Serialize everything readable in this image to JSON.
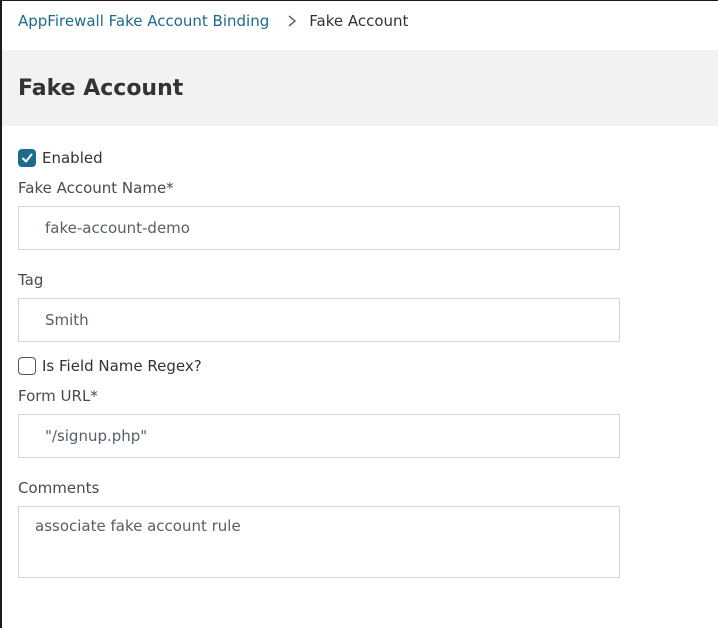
{
  "breadcrumb": {
    "parent": "AppFirewall Fake Account Binding",
    "current": "Fake Account"
  },
  "page": {
    "title": "Fake Account"
  },
  "form": {
    "enabled": {
      "label": "Enabled",
      "checked": true
    },
    "name": {
      "label": "Fake Account Name*",
      "value": "fake-account-demo"
    },
    "tag": {
      "label": "Tag",
      "value": "Smith"
    },
    "field_name_regex": {
      "label": "Is Field Name Regex?",
      "checked": false
    },
    "form_url": {
      "label": "Form URL*",
      "value": "\"/signup.php\""
    },
    "comments": {
      "label": "Comments",
      "value": "associate fake account rule"
    }
  },
  "colors": {
    "accent": "#1f6a8f",
    "header_band": "#f1f2f4",
    "input_border": "#d4d6da"
  },
  "icons": {
    "breadcrumb_separator": "chevron-right-icon",
    "checkmark": "checkmark-icon"
  }
}
